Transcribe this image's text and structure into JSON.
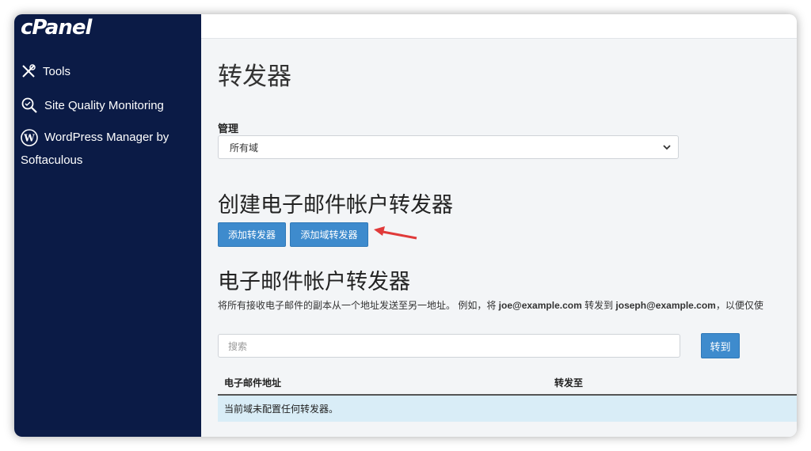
{
  "sidebar": {
    "logo": "cPanel",
    "items": [
      {
        "label": "Tools",
        "icon": "tools-icon"
      },
      {
        "label": "Site Quality Monitoring",
        "icon": "search-icon"
      },
      {
        "label": "WordPress Manager by Softaculous",
        "icon": "wordpress-icon"
      }
    ]
  },
  "main": {
    "title": "转发器",
    "manage_label": "管理",
    "domain_select": "所有域",
    "create_section_title": "创建电子邮件帐户转发器",
    "add_forwarder_button": "添加转发器",
    "add_domain_forwarder_button": "添加域转发器",
    "list_section_title": "电子邮件帐户转发器",
    "description": {
      "part1": "将所有接收电子邮件的副本从一个地址发送至另一地址。 例如，将 ",
      "email1": "joe@example.com",
      "part2": " 转发到 ",
      "email2": "joseph@example.com",
      "part3": "，以便仅使"
    },
    "search_placeholder": "搜索",
    "go_button": "转到",
    "table": {
      "headers": [
        "电子邮件地址",
        "转发至"
      ],
      "empty_message": "当前域未配置任何转发器。"
    }
  },
  "colors": {
    "sidebar_bg": "#0b1b46",
    "button_blue": "#3e8bcd",
    "row_highlight": "#d9edf7",
    "annotation_arrow": "#e03a3a"
  }
}
